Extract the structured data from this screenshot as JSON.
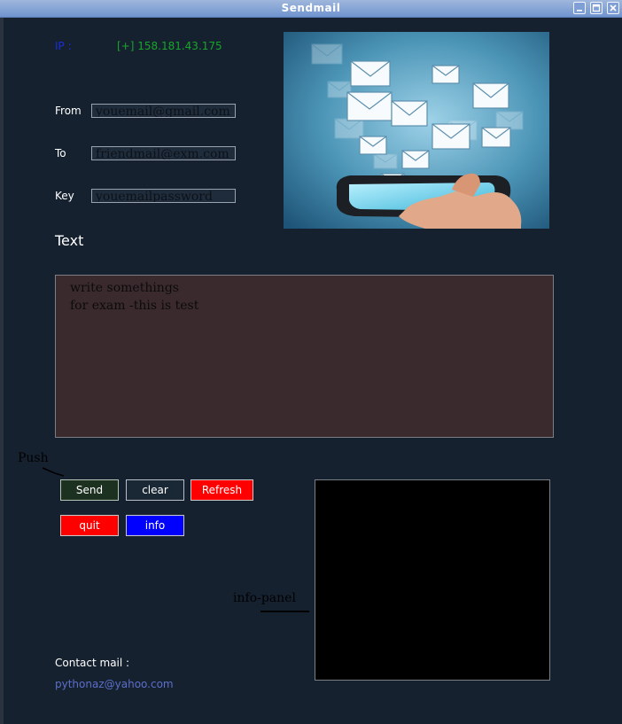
{
  "window": {
    "title": "Sendmail",
    "buttons": {
      "minimize": "–",
      "maximize": "□",
      "close": "✕"
    }
  },
  "header": {
    "ip_label": "IP :",
    "ip_value": "[+] 158.181.43.175"
  },
  "form": {
    "from_label": "From",
    "from_value": "youemail@gmail.com",
    "to_label": "To",
    "to_value": "friendmail@exm.com",
    "key_label": "Key",
    "key_value": "youemailpassword",
    "text_label": "Text",
    "message_line1": "write somethings",
    "message_line2": "for exam -this is test"
  },
  "annotations": {
    "push": "Push",
    "info_panel": "info-panel"
  },
  "actions": {
    "send": "Send",
    "clear": "clear",
    "refresh": "Refresh",
    "quit": "quit",
    "info": "info"
  },
  "footer": {
    "contact_label": "Contact mail :",
    "contact_email": "pythonaz@yahoo.com"
  },
  "colors": {
    "background": "#162130",
    "ip_label": "#1a2fd6",
    "ip_value": "#18a52a",
    "text_area": "#3b2a2d",
    "send_button": "#1c3120",
    "clear_button": "#1a2735",
    "refresh_button": "#ff0000",
    "quit_button": "#ff0000",
    "info_button": "#0000ff",
    "info_panel": "#000000",
    "contact_email": "#5b6fc9"
  },
  "icons": [
    "minimize-icon",
    "maximize-icon",
    "close-icon",
    "envelope-icon",
    "smartphone-icon"
  ]
}
